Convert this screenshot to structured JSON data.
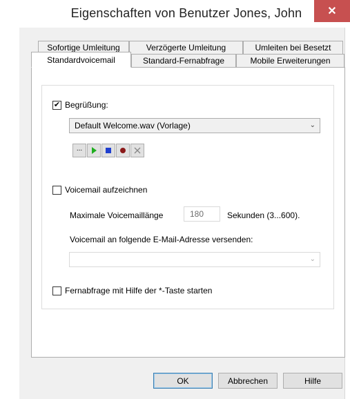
{
  "window": {
    "title": "Eigenschaften von Benutzer Jones, John",
    "close_glyph": "✕"
  },
  "tabs": {
    "row1": [
      {
        "label": "Sofortige Umleitung"
      },
      {
        "label": "Verzögerte Umleitung"
      },
      {
        "label": "Umleiten bei Besetzt"
      }
    ],
    "row2": [
      {
        "label": "Standardvoicemail",
        "active": true
      },
      {
        "label": "Standard-Fernabfrage"
      },
      {
        "label": "Mobile Erweiterungen"
      }
    ]
  },
  "greeting": {
    "checkbox_label": "Begrüßung:",
    "checked": true,
    "selected_file": "Default Welcome.wav (Vorlage)",
    "buttons": {
      "browse": "...",
      "play_icon": "play-icon",
      "stop_icon": "stop-icon",
      "record_icon": "record-icon",
      "delete_icon": "delete-icon"
    }
  },
  "voicemail": {
    "checkbox_label": "Voicemail aufzeichnen",
    "checked": false,
    "max_length_label": "Maximale Voicemaillänge",
    "max_length_value": "180",
    "seconds_label": "Sekunden (3...600).",
    "email_label": "Voicemail an folgende E-Mail-Adresse versenden:",
    "email_value": ""
  },
  "remote": {
    "checkbox_label": "Fernabfrage mit Hilfe der *-Taste starten",
    "checked": false
  },
  "footer": {
    "ok": "OK",
    "cancel": "Abbrechen",
    "help": "Hilfe"
  },
  "colors": {
    "close_bg": "#c75050",
    "play": "#1fae1f",
    "stop": "#1f3fcf",
    "record": "#8b1a1a"
  }
}
